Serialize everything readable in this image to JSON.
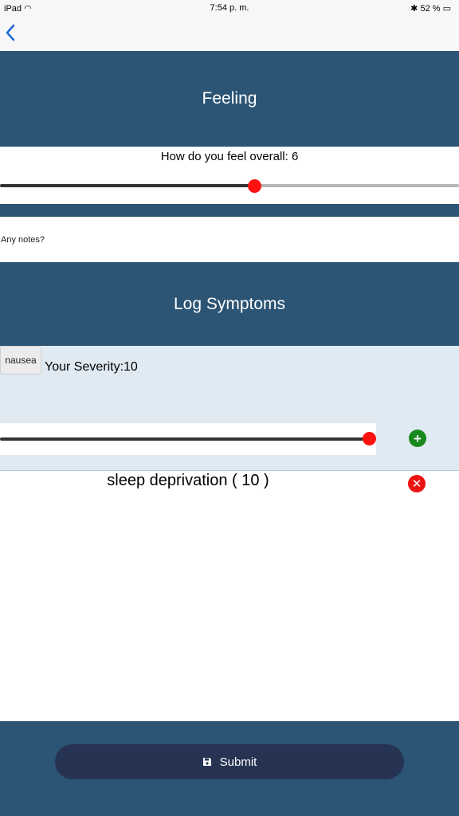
{
  "status_bar": {
    "device": "iPad",
    "time": "7:54 p. m.",
    "battery": "52 %"
  },
  "feeling": {
    "title": "Feeling",
    "overall_label": "How do you feel overall: 6",
    "overall_value": 6,
    "notes_placeholder": "Any notes?"
  },
  "symptoms": {
    "title": "Log Symptoms",
    "current_symptom": "nausea",
    "severity_label": "Your Severity:10",
    "severity_value": 10,
    "logged": [
      {
        "label": "sleep deprivation ( 10 )"
      }
    ]
  },
  "footer": {
    "submit_label": "Submit"
  },
  "colors": {
    "header": "#2c5474",
    "submit_button": "#263352",
    "thumb": "#ff1111",
    "add": "#18891c",
    "remove": "#ee1111"
  },
  "icons": [
    "wifi-icon",
    "bluetooth-icon",
    "battery-icon",
    "back-chevron-icon",
    "plus-icon",
    "close-icon",
    "save-icon"
  ]
}
